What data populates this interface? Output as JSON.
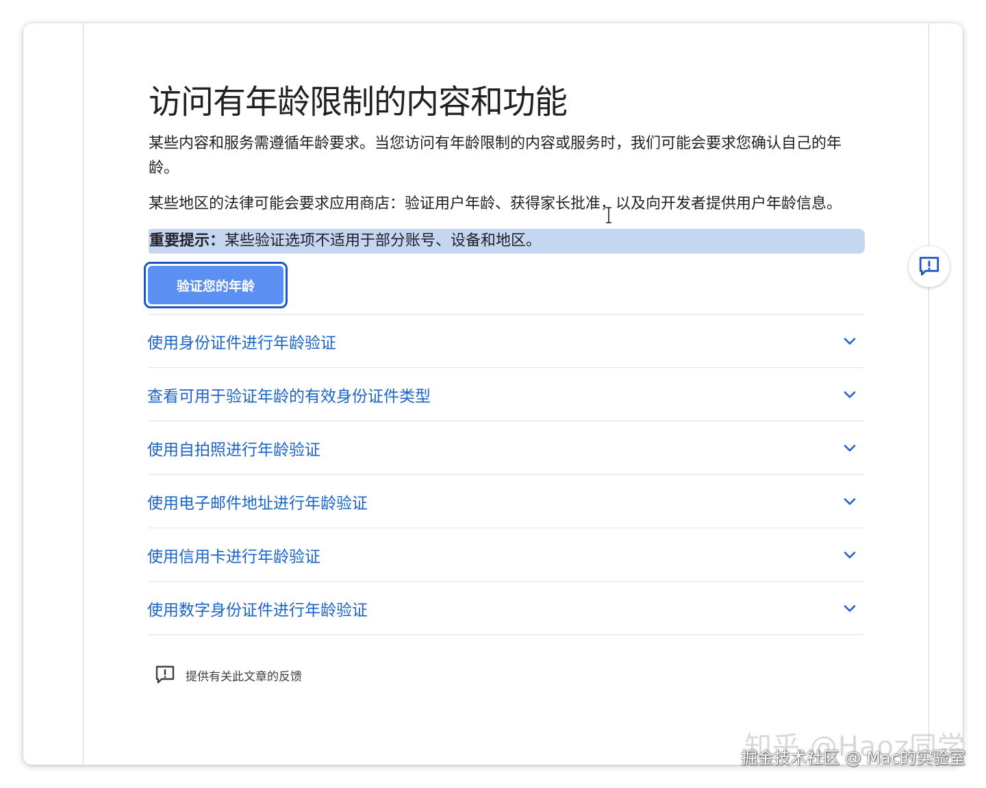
{
  "article": {
    "title": "访问有年龄限制的内容和功能",
    "paragraphs": [
      "某些内容和服务需遵循年龄要求。当您访问有年龄限制的内容或服务时，我们可能会要求您确认自己的年龄。",
      "某些地区的法律可能会要求应用商店：验证用户年龄、获得家长批准，以及向开发者提供用户年龄信息。"
    ],
    "notice_label": "重要提示：",
    "notice_text": "某些验证选项不适用于部分账号、设备和地区。",
    "verify_button": "验证您的年龄"
  },
  "accordion": {
    "items": [
      {
        "label": "使用身份证件进行年龄验证"
      },
      {
        "label": "查看可用于验证年龄的有效身份证件类型"
      },
      {
        "label": "使用自拍照进行年龄验证"
      },
      {
        "label": "使用电子邮件地址进行年龄验证"
      },
      {
        "label": "使用信用卡进行年龄验证"
      },
      {
        "label": "使用数字身份证件进行年龄验证"
      }
    ],
    "expand_icon": "chevron-down-icon"
  },
  "feedback": {
    "label": "提供有关此文章的反馈",
    "icon": "feedback-icon"
  },
  "floating_feedback": {
    "icon": "feedback-icon"
  },
  "watermark": {
    "line1": "知乎 @Haoz同学",
    "line2": "掘金技术社区 @ Mac的实验室"
  },
  "colors": {
    "link": "#1a63c8",
    "button": "#5b8ff2",
    "button_focus_ring": "#1a56c4",
    "notice_highlight": "#c5d6f3",
    "text": "#202124"
  }
}
